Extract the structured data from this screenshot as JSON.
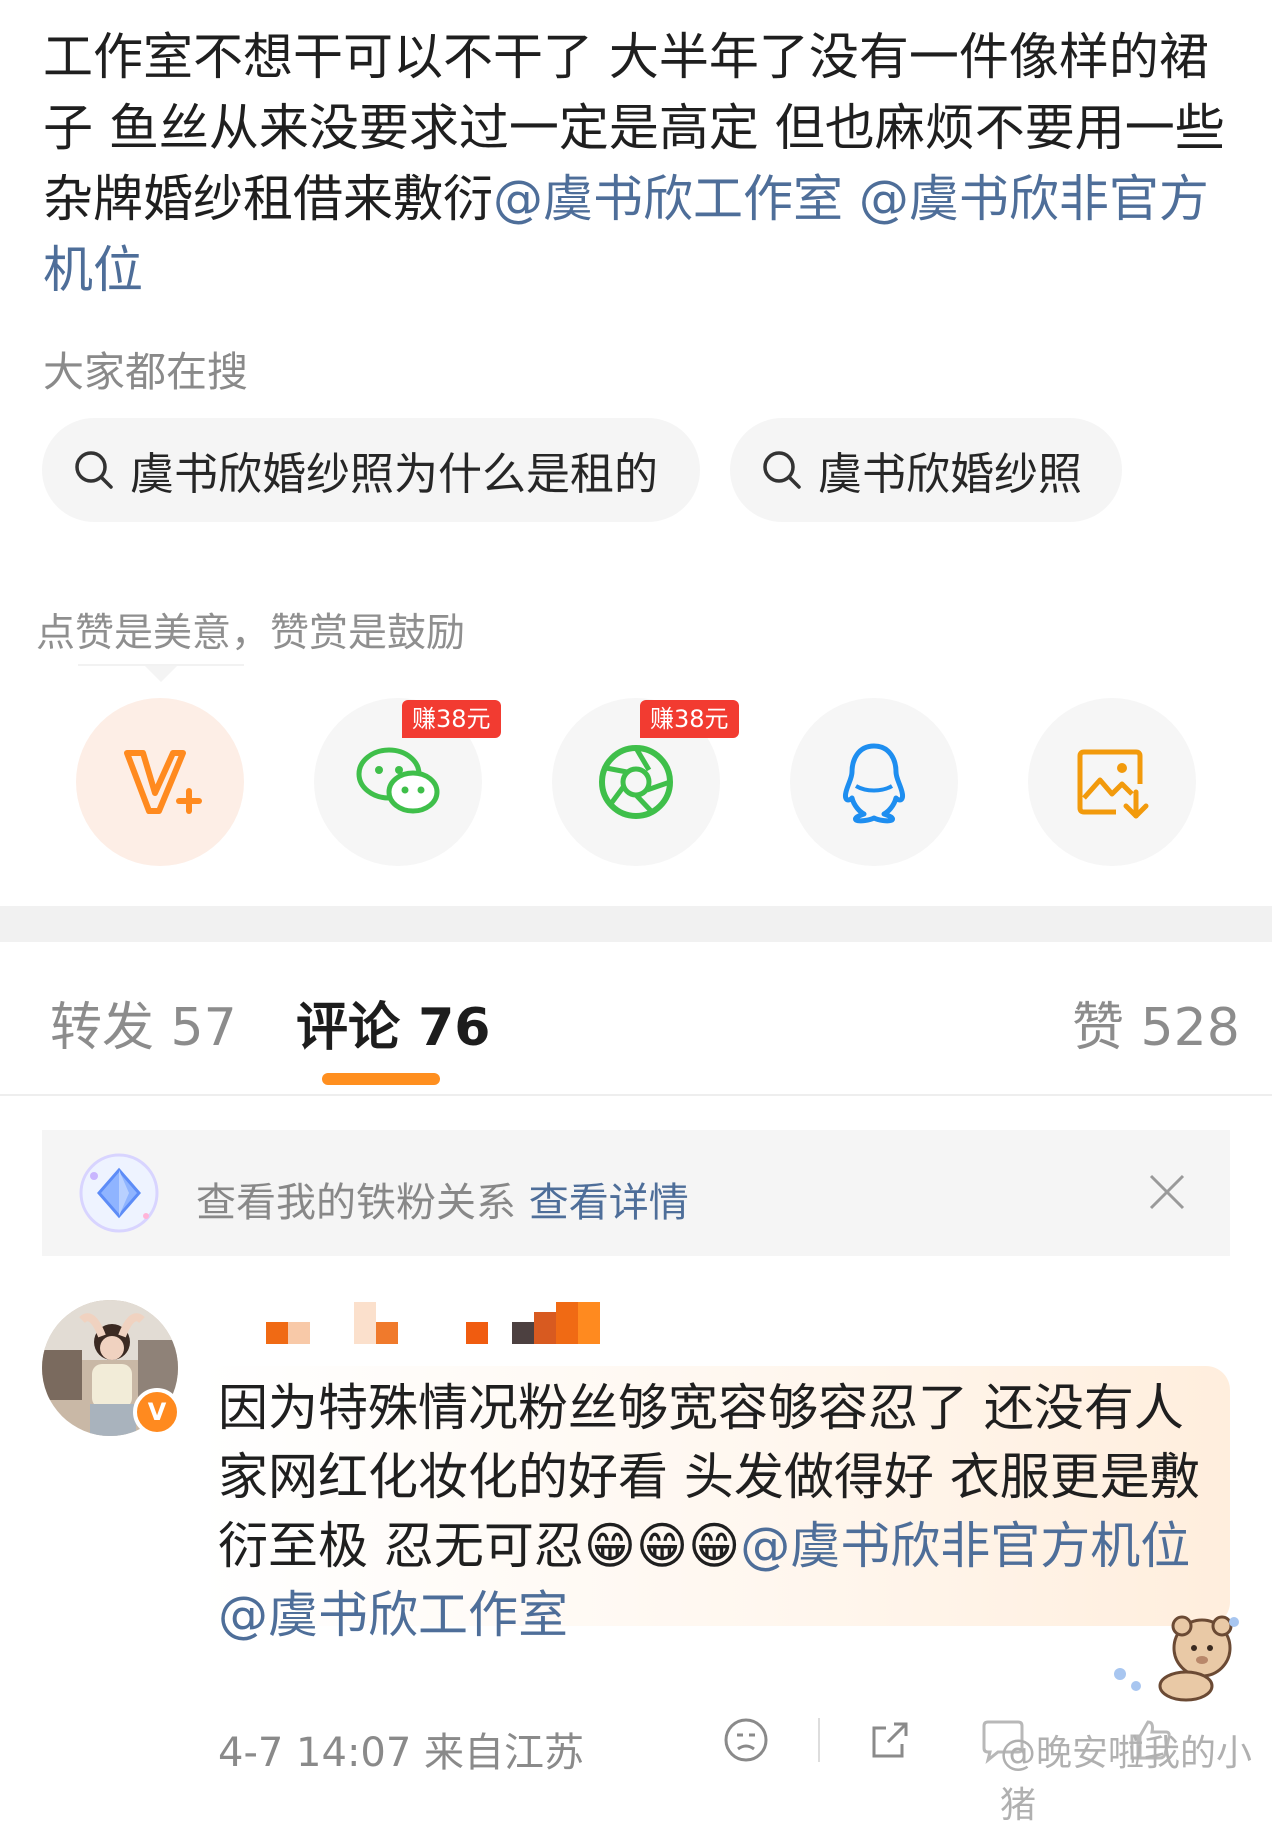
{
  "post": {
    "text": "工作室不想干可以不干了 大半年了没有一件像样的裙子 鱼丝从来没要求过一定是高定 但也麻烦不要用一些杂牌婚纱租借来敷衍",
    "mention_1": "@虞书欣工作室",
    "mention_2": "@虞书欣非官方机位"
  },
  "hot_search": {
    "label": "大家都在搜",
    "chips": [
      "虞书欣婚纱照为什么是租的",
      "虞书欣婚纱照"
    ]
  },
  "reward": {
    "caption": "点赞是美意，赞赏是鼓励",
    "earn_badge_1": "赚38元",
    "earn_badge_2": "赚38元",
    "icons": [
      "v-plus-icon",
      "wechat-icon",
      "moments-icon",
      "qq-icon",
      "save-image-icon"
    ]
  },
  "tabs": {
    "repost": "转发 57",
    "comments": "评论 76",
    "likes": "赞 528"
  },
  "fan_bar": {
    "text": "查看我的铁粉关系",
    "link": "查看详情"
  },
  "comment": {
    "badge": "V",
    "text": "因为特殊情况粉丝够宽容够容忍了 还没有人家网红化妆化的好看 头发做得好 衣服更是敷衍至极 忍无可忍😁😁😁",
    "mention_1": "@虞书欣非官方机位",
    "mention_2": "@虞书欣工作室",
    "meta": "4-7 14:07 来自江苏"
  },
  "watermark": "@晚安啦我的小猪",
  "colors": {
    "accent_orange": "#ff8f1f",
    "link_blue": "#4e6e99",
    "earn_red": "#f23b31",
    "wechat_green": "#3fbf4a",
    "qq_blue": "#1e8ef0"
  }
}
